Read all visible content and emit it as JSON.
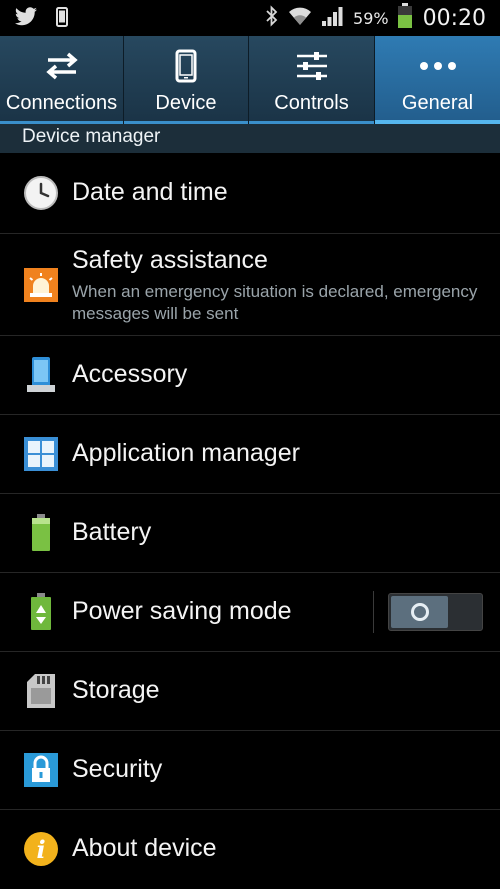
{
  "status_bar": {
    "battery_percent": "59%",
    "time": "00:20",
    "icons": [
      "twitter-icon",
      "phone-notification-icon",
      "bluetooth-icon",
      "wifi-icon",
      "signal-icon",
      "battery-icon"
    ]
  },
  "tabs": [
    {
      "label": "Connections",
      "icon": "swap-arrows-icon",
      "active": false
    },
    {
      "label": "Device",
      "icon": "phone-icon",
      "active": false
    },
    {
      "label": "Controls",
      "icon": "sliders-icon",
      "active": false
    },
    {
      "label": "General",
      "icon": "more-dots-icon",
      "active": true
    }
  ],
  "section_header": "Device manager",
  "items": [
    {
      "title": "Date and time",
      "icon": "clock-icon"
    },
    {
      "title": "Safety assistance",
      "subtitle": "When an emergency situation is declared, emergency messages will be sent",
      "icon": "emergency-light-icon"
    },
    {
      "title": "Accessory",
      "icon": "accessory-icon"
    },
    {
      "title": "Application manager",
      "icon": "app-grid-icon"
    },
    {
      "title": "Battery",
      "icon": "battery-green-icon"
    },
    {
      "title": "Power saving mode",
      "icon": "power-saving-icon",
      "toggle": "off"
    },
    {
      "title": "Storage",
      "icon": "sd-card-icon"
    },
    {
      "title": "Security",
      "icon": "lock-icon"
    },
    {
      "title": "About device",
      "icon": "info-icon"
    }
  ],
  "colors": {
    "active_tab": "#2f7bb3",
    "inactive_tab": "#1f3a50",
    "section_header_bg": "#1c2e3a",
    "battery_green": "#7ac143"
  }
}
